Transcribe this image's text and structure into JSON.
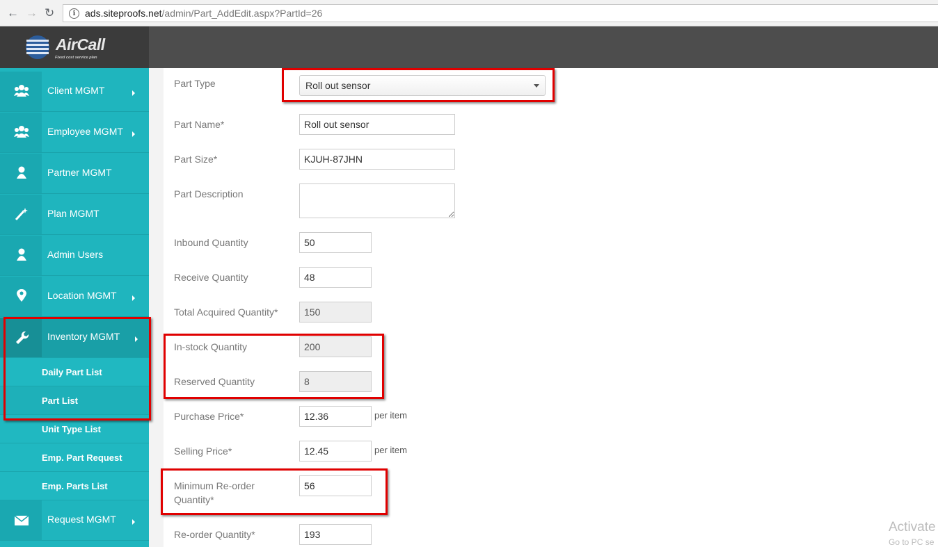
{
  "browser": {
    "url_host": "ads.siteproofs.net",
    "url_path": "/admin/Part_AddEdit.aspx?PartId=26"
  },
  "brand": {
    "name": "AirCall",
    "tagline": "Fixed cost service plan"
  },
  "sidebar": {
    "items": [
      {
        "label": "Client MGMT",
        "icon": "users-icon"
      },
      {
        "label": "Employee MGMT",
        "icon": "users-icon"
      },
      {
        "label": "Partner MGMT",
        "icon": "user-icon"
      },
      {
        "label": "Plan MGMT",
        "icon": "magic-wand-icon"
      },
      {
        "label": "Admin Users",
        "icon": "user-icon"
      },
      {
        "label": "Location MGMT",
        "icon": "map-marker-icon"
      },
      {
        "label": "Inventory MGMT",
        "icon": "wrench-icon"
      },
      {
        "label": "Request MGMT",
        "icon": "envelope-icon"
      }
    ],
    "sub_items": [
      "Daily Part List",
      "Part List",
      "Unit Type List",
      "Emp. Part Request",
      "Emp. Parts List"
    ]
  },
  "form": {
    "part_type": {
      "label": "Part Type",
      "value": "Roll out sensor"
    },
    "part_name": {
      "label": "Part Name*",
      "value": "Roll out sensor"
    },
    "part_size": {
      "label": "Part Size*",
      "value": "KJUH-87JHN"
    },
    "part_description": {
      "label": "Part Description",
      "value": ""
    },
    "inbound_quantity": {
      "label": "Inbound Quantity",
      "value": "50"
    },
    "receive_quantity": {
      "label": "Receive Quantity",
      "value": "48"
    },
    "total_acquired_quantity": {
      "label": "Total Acquired Quantity*",
      "value": "150"
    },
    "in_stock_quantity": {
      "label": "In-stock Quantity",
      "value": "200"
    },
    "reserved_quantity": {
      "label": "Reserved Quantity",
      "value": "8"
    },
    "purchase_price": {
      "label": "Purchase Price*",
      "value": "12.36",
      "suffix": "per item"
    },
    "selling_price": {
      "label": "Selling Price*",
      "value": "12.45",
      "suffix": "per item"
    },
    "minimum_reorder_quantity": {
      "label_line1": "Minimum Re-order",
      "label_line2": "Quantity*",
      "value": "56"
    },
    "reorder_quantity": {
      "label": "Re-order Quantity*",
      "value": "193"
    }
  },
  "watermark": {
    "line1": "Activate",
    "line2": "Go to PC se"
  },
  "colors": {
    "sidebar": "#1fb5be",
    "header": "#4d4d4d",
    "highlight": "#e00000"
  }
}
